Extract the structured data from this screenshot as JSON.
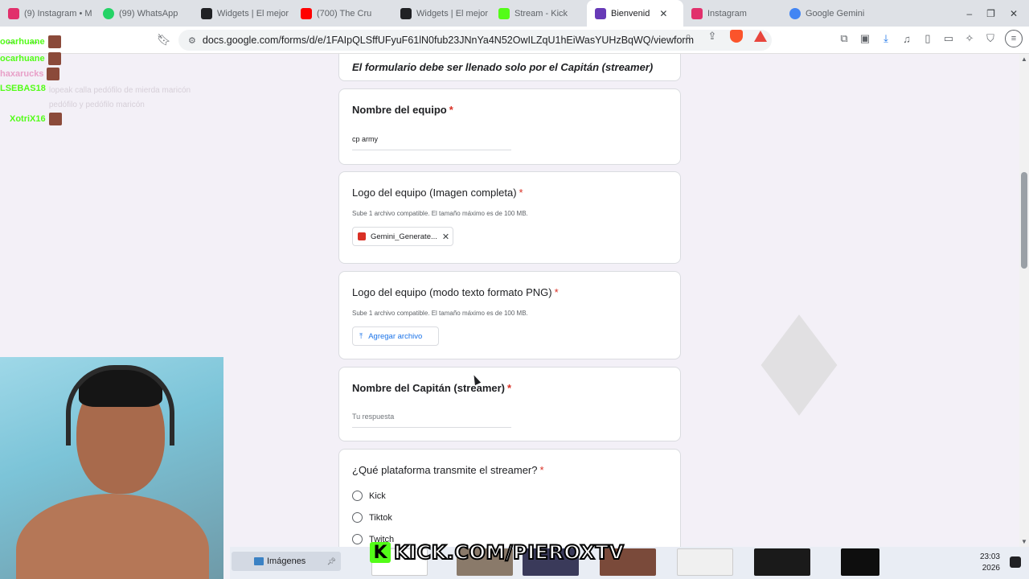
{
  "browser": {
    "tabs": [
      {
        "label": "(9) Instagram • M",
        "color": "#e1306c",
        "active": false
      },
      {
        "label": "(99) WhatsApp",
        "color": "#25d366",
        "active": false
      },
      {
        "label": "Widgets | El mejor",
        "color": "#202124",
        "active": false
      },
      {
        "label": "(700) The Cru",
        "color": "#ff0000",
        "active": false
      },
      {
        "label": "Widgets | El mejor",
        "color": "#202124",
        "active": false
      },
      {
        "label": "Stream - Kick",
        "color": "#53fc18",
        "active": false
      },
      {
        "label": "Bienvenid",
        "color": "#673ab7",
        "active": true
      },
      {
        "label": "Instagram",
        "color": "#e1306c",
        "active": false
      },
      {
        "label": "Google Gemini",
        "color": "#4285f4",
        "active": false
      }
    ],
    "tab_close": "✕",
    "url": "docs.google.com/forms/d/e/1FAIpQLSffUFyuF61lN0fub23JNnYa4N52OwILZqU1hEiWasYUHzBqWQ/viewform"
  },
  "form": {
    "header_note": "El formulario debe ser llenado solo por el Capitán (streamer)",
    "required_mark": "*",
    "team_name": {
      "title": "Nombre del equipo",
      "value": "cp army"
    },
    "logo_full": {
      "title": "Logo del equipo (Imagen completa)",
      "desc": "Sube 1 archivo compatible. El tamaño máximo es de 100 MB.",
      "file_name": "Gemini_Generate...",
      "remove": "✕"
    },
    "logo_text": {
      "title": "Logo del equipo (modo texto formato PNG)",
      "desc": "Sube 1 archivo compatible. El tamaño máximo es de 100 MB.",
      "upload_label": "Agregar archivo"
    },
    "captain_name": {
      "title": "Nombre del Capitán (streamer)",
      "placeholder": "Tu respuesta"
    },
    "platform": {
      "title": "¿Qué plataforma transmite el streamer?",
      "options": [
        "Kick",
        "Tiktok",
        "Twitch"
      ]
    }
  },
  "chat": [
    {
      "user": "ocarhuane",
      "msg": "",
      "color": "#53fc18"
    },
    {
      "user": "ocarhuane",
      "msg": "",
      "color": "#53fc18"
    },
    {
      "user": "haxarucks",
      "msg": "",
      "color": "#e8a0c8"
    },
    {
      "user": "LSEBAS18",
      "msg": "lopeak calla pedófilo de mierda maricón pedófilo y pedófilo maricón",
      "color": "#53fc18"
    },
    {
      "user": "XotriX16",
      "msg": "",
      "color": "#53fc18"
    }
  ],
  "taskbar": {
    "folder_label": "Imágenes",
    "time": "23:03",
    "date": "2026"
  },
  "overlay": {
    "banner": "KICK.COM/PIEROXTV",
    "banner_k": "K"
  }
}
